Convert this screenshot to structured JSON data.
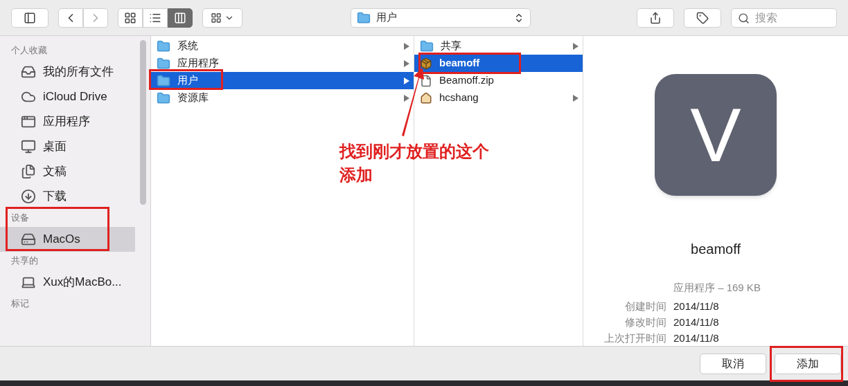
{
  "toolbar": {
    "view_modes": [
      {
        "kind": "icons",
        "selected": false
      },
      {
        "kind": "list",
        "selected": false
      },
      {
        "kind": "columns",
        "selected": true
      }
    ],
    "path": "用户",
    "search": {
      "placeholder": "搜索"
    }
  },
  "sidebar": {
    "sections": [
      {
        "title": "个人收藏",
        "annotated": false,
        "items": [
          {
            "kind": "files",
            "label": "我的所有文件",
            "selected": false
          },
          {
            "kind": "cloud",
            "label": "iCloud Drive",
            "selected": false
          },
          {
            "kind": "apps",
            "label": "应用程序",
            "selected": false
          },
          {
            "kind": "desktop",
            "label": "桌面",
            "selected": false
          },
          {
            "kind": "documents",
            "label": "文稿",
            "selected": false
          },
          {
            "kind": "downloads",
            "label": "下载",
            "selected": false
          }
        ]
      },
      {
        "title": "设备",
        "annotated": true,
        "items": [
          {
            "kind": "disk",
            "label": "MacOs",
            "selected": true
          }
        ]
      },
      {
        "title": "共享的",
        "annotated": false,
        "items": [
          {
            "kind": "computer",
            "label": "Xux的MacBo..."
          }
        ]
      },
      {
        "title": "标记",
        "annotated": false
      }
    ]
  },
  "columns": [
    {
      "items": [
        {
          "kind": "folder",
          "label": "系统",
          "has_children": true,
          "selected": false,
          "annotated": false
        },
        {
          "kind": "folder",
          "label": "应用程序",
          "has_children": true,
          "selected": false,
          "annotated": false
        },
        {
          "kind": "folder",
          "label": "用户",
          "has_children": true,
          "selected": true,
          "annotated": true
        },
        {
          "kind": "folder",
          "label": "资源库",
          "has_children": true,
          "selected": false,
          "annotated": false
        }
      ]
    },
    {
      "items": [
        {
          "kind": "folder",
          "label": "共享",
          "has_children": true,
          "selected": false,
          "annotated": false
        },
        {
          "kind": "app",
          "label": "beamoff",
          "has_children": false,
          "selected": true,
          "annotated": true
        },
        {
          "kind": "file",
          "label": "Beamoff.zip",
          "has_children": false,
          "selected": false,
          "annotated": false
        },
        {
          "kind": "home",
          "label": "hcshang",
          "has_children": true,
          "selected": false,
          "annotated": false
        }
      ]
    }
  ],
  "annotation": {
    "text": "找到刚才放置的这个添加"
  },
  "preview": {
    "icon_letter": "V",
    "name": "beamoff",
    "summary": "应用程序 – 169 KB",
    "details": [
      {
        "label": "创建时间",
        "value": "2014/11/8"
      },
      {
        "label": "修改时间",
        "value": "2014/11/8"
      },
      {
        "label": "上次打开时间",
        "value": "2014/11/8"
      }
    ]
  },
  "buttons": [
    {
      "label": "取消",
      "annotated": false
    },
    {
      "label": "添加",
      "annotated": true
    }
  ]
}
